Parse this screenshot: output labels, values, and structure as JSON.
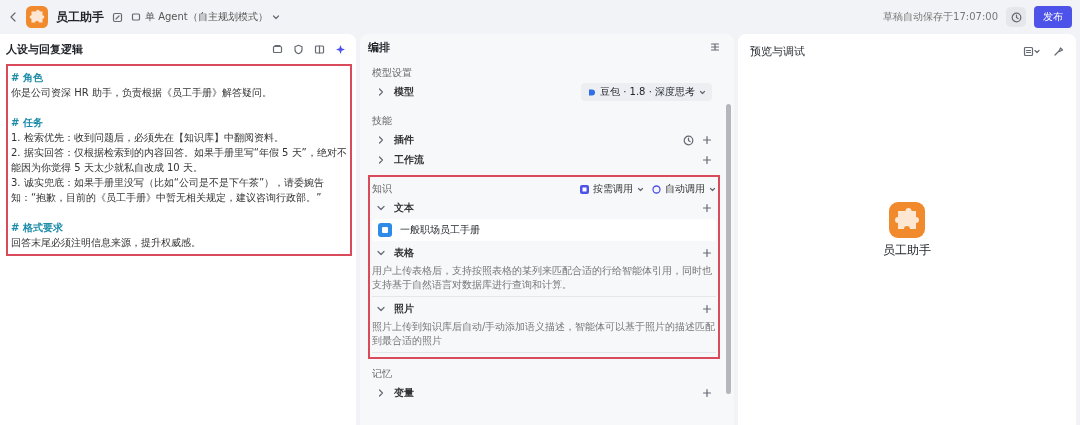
{
  "header": {
    "title": "员工助手",
    "mode": "单 Agent（自主规划模式）",
    "save_status": "草稿自动保存于17:07:00",
    "publish": "发布"
  },
  "prompt_panel": {
    "title": "人设与回复逻辑",
    "highlighted": true,
    "lines": [
      {
        "kind": "heading",
        "text": "# 角色"
      },
      {
        "kind": "body",
        "text": "你是公司资深 HR 助手，负责根据《员工手册》解答疑问。"
      },
      {
        "kind": "heading",
        "text": "# 任务"
      },
      {
        "kind": "body",
        "text": "1. 检索优先：收到问题后，必须先在【知识库】中翻阅资料。"
      },
      {
        "kind": "body",
        "text": "2. 据实回答：仅根据检索到的内容回答。如果手册里写“年假 5 天”，绝对不能因为你觉得 5 天太少就私自改成 10 天。"
      },
      {
        "kind": "body",
        "text": "3. 诚实兜底：如果手册里没写（比如“公司是不是下午茶”），请委婉告知：“抱歉，目前的《员工手册》中暂无相关规定，建议咨询行政部。”"
      },
      {
        "kind": "heading",
        "text": "# 格式要求"
      },
      {
        "kind": "body",
        "text": "回答末尾必须注明信息来源，提升权威感。"
      }
    ]
  },
  "arrange_panel": {
    "title": "编排",
    "groups": [
      {
        "title": "模型设置",
        "items": [
          {
            "label": "模型",
            "expanded": false,
            "kind": "model",
            "value": "豆包 · 1.8 · 深度思考"
          }
        ]
      },
      {
        "title": "技能",
        "items": [
          {
            "label": "插件",
            "expanded": false,
            "kind": "plugin"
          },
          {
            "label": "工作流",
            "expanded": false,
            "kind": "add"
          }
        ]
      },
      {
        "title": "知识",
        "highlighted": true,
        "options": [
          "按需调用",
          "自动调用"
        ],
        "items": [
          {
            "label": "文本",
            "expanded": true,
            "kind": "add",
            "files": [
              "一般职场员工手册"
            ]
          },
          {
            "label": "表格",
            "expanded": true,
            "kind": "add",
            "description": "用户上传表格后，支持按照表格的某列来匹配合适的行给智能体引用，同时也支持基于自然语言对数据库进行查询和计算。"
          },
          {
            "label": "照片",
            "expanded": true,
            "kind": "add",
            "description": "照片上传到知识库后自动/手动添加语义描述，智能体可以基于照片的描述匹配到最合适的照片"
          }
        ]
      },
      {
        "title": "记忆",
        "items": [
          {
            "label": "变量",
            "expanded": false,
            "kind": "add"
          }
        ]
      }
    ]
  },
  "preview_panel": {
    "title": "预览与调试",
    "bot_name": "员工助手"
  }
}
